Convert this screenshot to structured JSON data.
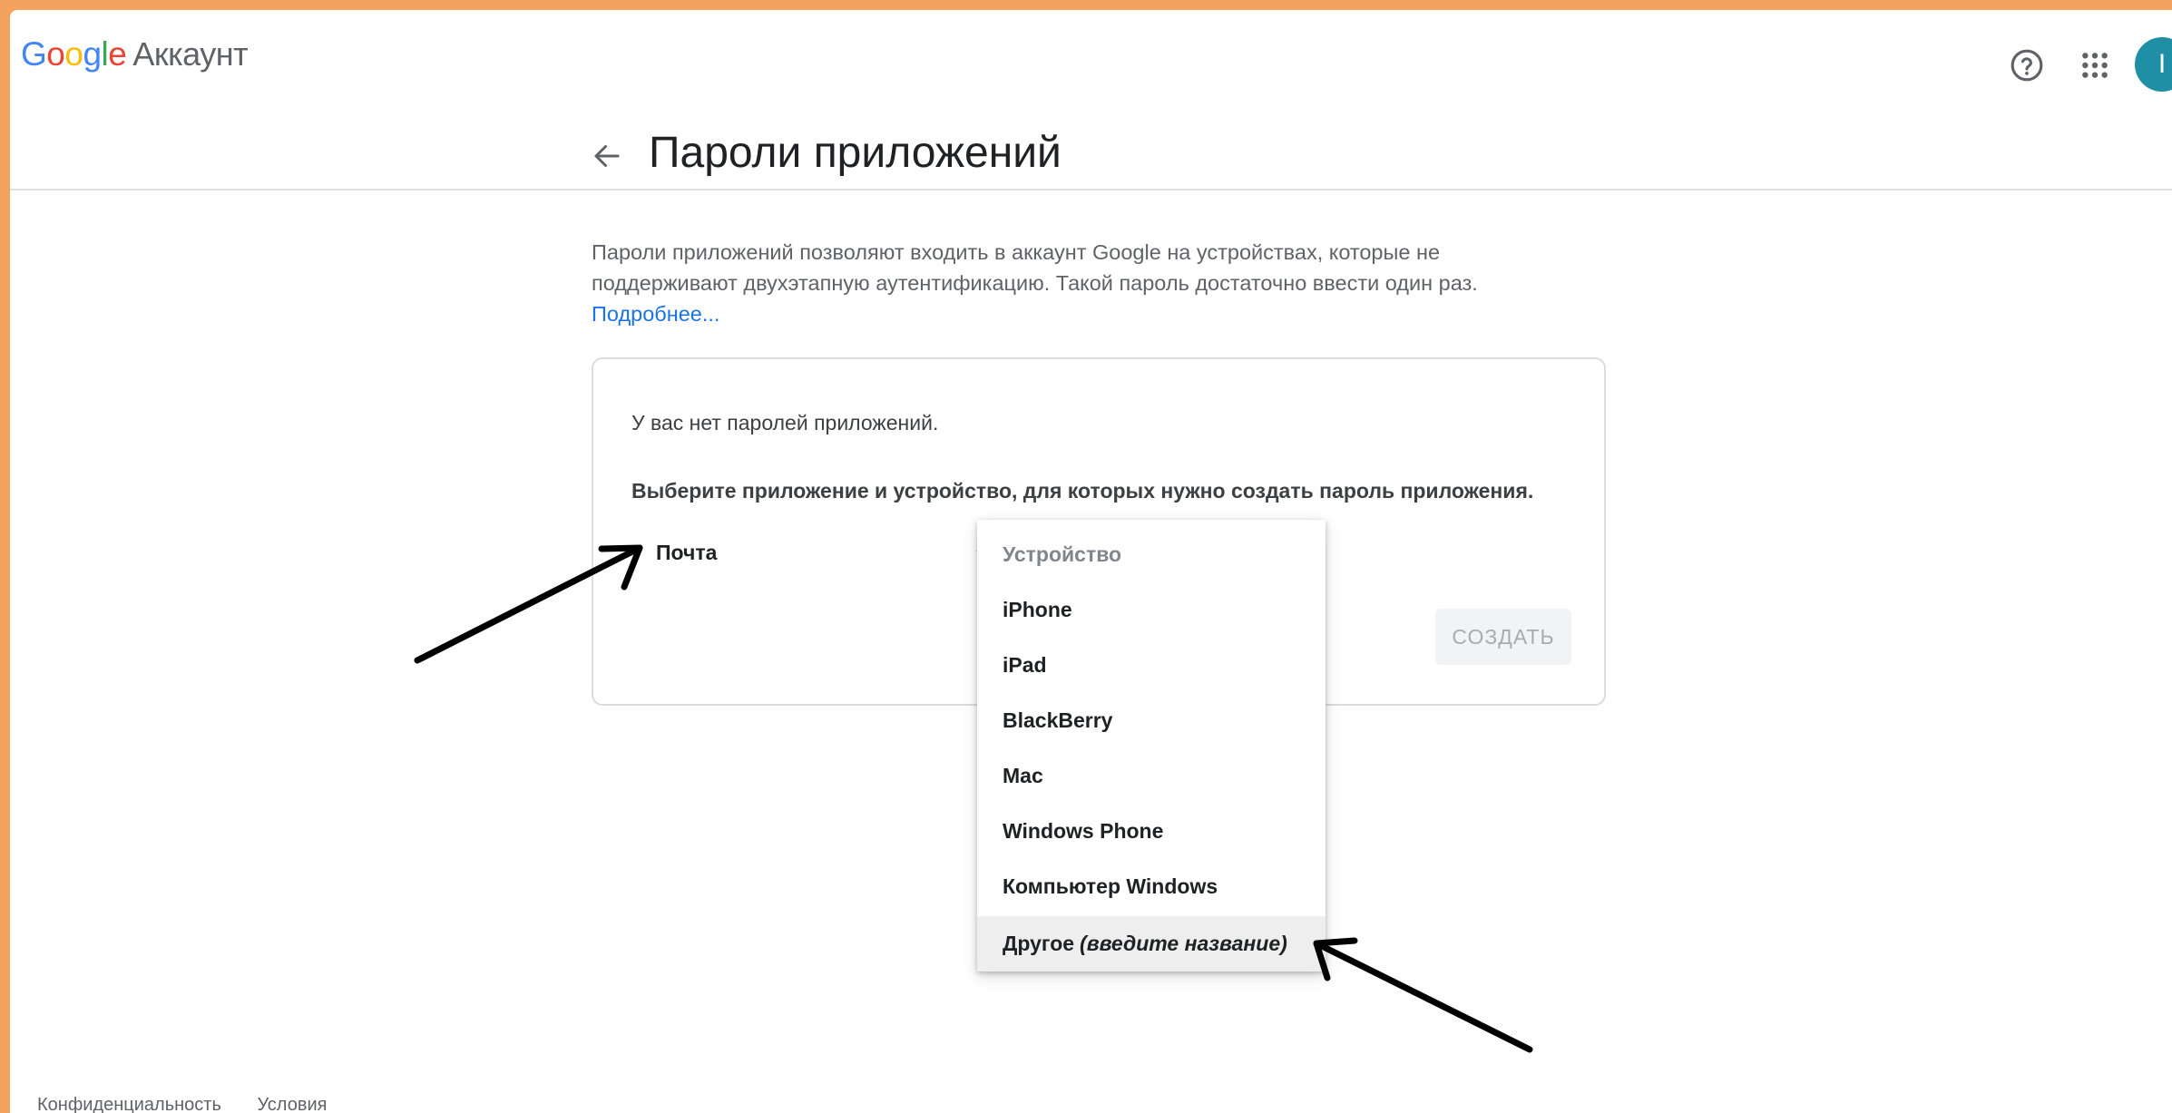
{
  "header": {
    "logo": {
      "letters": [
        {
          "ch": "G",
          "color": "#4285F4"
        },
        {
          "ch": "o",
          "color": "#EA4335"
        },
        {
          "ch": "o",
          "color": "#FBBC05"
        },
        {
          "ch": "g",
          "color": "#4285F4"
        },
        {
          "ch": "l",
          "color": "#34A853"
        },
        {
          "ch": "e",
          "color": "#EA4335"
        }
      ],
      "product": "Аккаунт"
    },
    "icons": [
      "help-icon",
      "apps-grid-icon"
    ],
    "avatar_initial": "I"
  },
  "title": {
    "back_icon": "arrow-left-icon",
    "text": "Пароли приложений"
  },
  "description": {
    "line1": "Пароли приложений позволяют входить в аккаунт Google на устройствах, которые не",
    "line2": "поддерживают двухэтапную аутентификацию. Такой пароль достаточно ввести один раз.",
    "link": "Подробнее..."
  },
  "card": {
    "no_passwords": "У вас нет паролей приложений.",
    "instruction": "Выберите приложение и устройство, для которых нужно создать пароль приложения.",
    "app_select_value": "Почта",
    "create_button": "СОЗДАТЬ"
  },
  "device_menu": {
    "header": "Устройство",
    "options": [
      "iPhone",
      "iPad",
      "BlackBerry",
      "Mac",
      "Windows Phone",
      "Компьютер Windows"
    ],
    "other_label": "Другое",
    "other_hint": "(введите название)"
  },
  "footer": {
    "privacy": "Конфиденциальность",
    "terms": "Условия"
  },
  "colors": {
    "frame": "#F4A35E",
    "link": "#1A73E8",
    "avatar": "#1F8FA5"
  }
}
